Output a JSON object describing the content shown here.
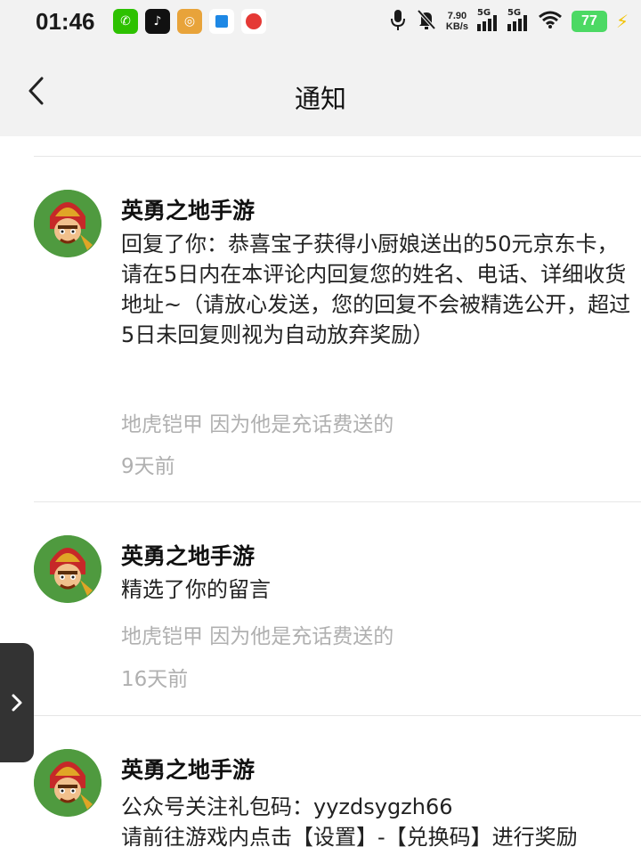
{
  "status_bar": {
    "time": "01:46",
    "net_speed_value": "7.90",
    "net_speed_unit": "KB/s",
    "signal1_label": "5G",
    "signal2_label": "5G",
    "battery": "77",
    "app_icons": [
      "wechat-icon",
      "tiktok-icon",
      "app-icon-3",
      "app-icon-4",
      "app-icon-5"
    ]
  },
  "nav": {
    "back_icon": "chevron-left-icon",
    "title": "通知"
  },
  "notifications": [
    {
      "user": "英勇之地手游",
      "text": "回复了你：恭喜宝子获得小厨娘送出的50元京东卡，请在5日内在本评论内回复您的姓名、电话、详细收货地址~（请放心发送，您的回复不会被精选公开，超过5日未回复则视为自动放弃奖励）",
      "quote": "地虎铠甲 因为他是充话费送的",
      "time": "9天前"
    },
    {
      "user": "英勇之地手游",
      "text": "精选了你的留言",
      "quote": "地虎铠甲 因为他是充话费送的",
      "time": "16天前"
    },
    {
      "user": "英勇之地手游",
      "text_line1": "公众号关注礼包码：yyzdsygzh66",
      "text_line2": "请前往游戏内点击【设置】-【兑换码】进行奖励"
    }
  ],
  "side_handle_icon": "chevron-right-icon"
}
